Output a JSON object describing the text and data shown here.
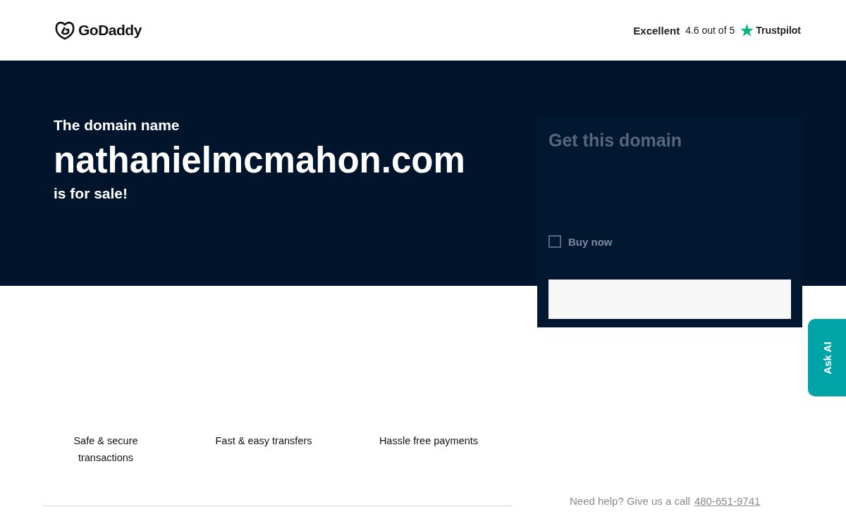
{
  "header": {
    "logo": "GoDaddy",
    "rating": {
      "label": "Excellent",
      "score": "4.6 out of 5",
      "brand": "Trustpilot"
    }
  },
  "hero": {
    "intro": "The domain name",
    "domain": "nathanielmcmahon.com",
    "outro": "is for sale!"
  },
  "purchase_card": {
    "title": "Get this domain",
    "option": "Buy now",
    "help": "Need help? Give us a call",
    "phone": "480-651-9741"
  },
  "features": [
    {
      "label": "Safe & secure transactions"
    },
    {
      "label": "Fast & easy transfers"
    },
    {
      "label": "Hassle free payments"
    }
  ],
  "ask_ai": {
    "label": "Ask AI"
  }
}
